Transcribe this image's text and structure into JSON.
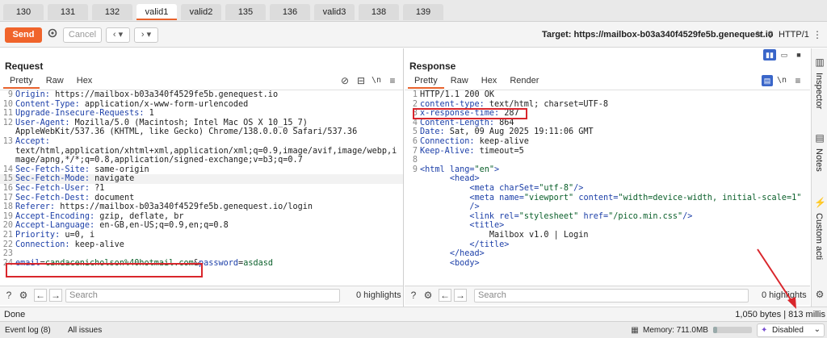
{
  "tabs": [
    "130",
    "131",
    "132",
    "valid1",
    "valid2",
    "135",
    "136",
    "valid3",
    "138",
    "139"
  ],
  "active_tab": "valid1",
  "toolbar": {
    "send_label": "Send",
    "cancel_label": "Cancel",
    "target_label": "Target: https://mailbox-b03a340f4529fe5b.genequest.io",
    "http_version": "HTTP/1"
  },
  "request": {
    "title": "Request",
    "tabs": [
      "Pretty",
      "Raw",
      "Hex"
    ],
    "newline_label": "\\n",
    "lines": [
      {
        "n": "9",
        "k": "Origin:",
        "v": " https://mailbox-b03a340f4529fe5b.genequest.io"
      },
      {
        "n": "10",
        "k": "Content-Type:",
        "v": " application/x-www-form-urlencoded"
      },
      {
        "n": "11",
        "k": "Upgrade-Insecure-Requests:",
        "v": " 1"
      },
      {
        "n": "12",
        "k": "User-Agent:",
        "v": " Mozilla/5.0 (Macintosh; Intel Mac OS X 10_15_7)"
      },
      {
        "n": "",
        "k": "",
        "v": "AppleWebKit/537.36 (KHTML, like Gecko) Chrome/138.0.0.0 Safari/537.36"
      },
      {
        "n": "13",
        "k": "Accept:",
        "v": ""
      },
      {
        "n": "",
        "k": "",
        "v": "text/html,application/xhtml+xml,application/xml;q=0.9,image/avif,image/webp,i"
      },
      {
        "n": "",
        "k": "",
        "v": "mage/apng,*/*;q=0.8,application/signed-exchange;v=b3;q=0.7"
      },
      {
        "n": "14",
        "k": "Sec-Fetch-Site:",
        "v": " same-origin"
      },
      {
        "n": "15",
        "k": "Sec-Fetch-Mode:",
        "v": " navigate"
      },
      {
        "n": "16",
        "k": "Sec-Fetch-User:",
        "v": " ?1"
      },
      {
        "n": "17",
        "k": "Sec-Fetch-Dest:",
        "v": " document"
      },
      {
        "n": "18",
        "k": "Referer:",
        "v": " https://mailbox-b03a340f4529fe5b.genequest.io/login"
      },
      {
        "n": "19",
        "k": "Accept-Encoding:",
        "v": " gzip, deflate, br"
      },
      {
        "n": "20",
        "k": "Accept-Language:",
        "v": " en-GB,en-US;q=0.9,en;q=0.8"
      },
      {
        "n": "21",
        "k": "Priority:",
        "v": " u=0, i"
      },
      {
        "n": "22",
        "k": "Connection:",
        "v": " keep-alive"
      },
      {
        "n": "23",
        "k": "",
        "v": ""
      }
    ],
    "body_line": {
      "n": "24",
      "p1k": "email",
      "p1v": "candacenicholson%40hotmail.com",
      "amp": "&",
      "p2k": "password",
      "p2v": "asdasd"
    },
    "search_placeholder": "Search",
    "highlights": "0 highlights"
  },
  "response": {
    "title": "Response",
    "tabs": [
      "Pretty",
      "Raw",
      "Hex",
      "Render"
    ],
    "newline_label": "\\n",
    "header_lines": [
      {
        "n": "1",
        "k": "",
        "v": "HTTP/1.1 200 OK"
      },
      {
        "n": "2",
        "k": "content-type:",
        "v": " text/html; charset=UTF-8"
      },
      {
        "n": "3",
        "k": "x-response-time:",
        "v": " 287"
      },
      {
        "n": "4",
        "k": "Content-Length:",
        "v": " 864"
      },
      {
        "n": "5",
        "k": "Date:",
        "v": " Sat, 09 Aug 2025 19:11:06 GMT"
      },
      {
        "n": "6",
        "k": "Connection:",
        "v": " keep-alive"
      },
      {
        "n": "7",
        "k": "Keep-Alive:",
        "v": " timeout=5"
      },
      {
        "n": "8",
        "k": "",
        "v": ""
      }
    ],
    "html_lines": [
      {
        "n": "9",
        "indent": "",
        "parts": [
          [
            "t",
            "<html "
          ],
          [
            "a",
            "lang"
          ],
          [
            "t",
            "="
          ],
          [
            "s",
            "\"en\""
          ],
          [
            "t",
            ">"
          ]
        ]
      },
      {
        "n": "",
        "indent": "      ",
        "parts": [
          [
            "t",
            "<head>"
          ]
        ]
      },
      {
        "n": "",
        "indent": "          ",
        "parts": [
          [
            "t",
            "<meta "
          ],
          [
            "a",
            "charSet"
          ],
          [
            "t",
            "="
          ],
          [
            "s",
            "\"utf-8\""
          ],
          [
            "t",
            "/>"
          ]
        ]
      },
      {
        "n": "",
        "indent": "          ",
        "parts": [
          [
            "t",
            "<meta "
          ],
          [
            "a",
            "name"
          ],
          [
            "t",
            "="
          ],
          [
            "s",
            "\"viewport\""
          ],
          [
            "t",
            " "
          ],
          [
            "a",
            "content"
          ],
          [
            "t",
            "="
          ],
          [
            "s",
            "\"width=device-width, initial-scale=1\""
          ]
        ]
      },
      {
        "n": "",
        "indent": "          ",
        "parts": [
          [
            "t",
            "/>"
          ]
        ]
      },
      {
        "n": "",
        "indent": "          ",
        "parts": [
          [
            "t",
            "<link "
          ],
          [
            "a",
            "rel"
          ],
          [
            "t",
            "="
          ],
          [
            "s",
            "\"stylesheet\""
          ],
          [
            "t",
            " "
          ],
          [
            "a",
            "href"
          ],
          [
            "t",
            "="
          ],
          [
            "s",
            "\"/pico.min.css\""
          ],
          [
            "t",
            "/>"
          ]
        ]
      },
      {
        "n": "",
        "indent": "          ",
        "parts": [
          [
            "t",
            "<title>"
          ]
        ]
      },
      {
        "n": "",
        "indent": "              ",
        "parts": [
          [
            "p",
            "Mailbox v1.0 | Login"
          ]
        ]
      },
      {
        "n": "",
        "indent": "          ",
        "parts": [
          [
            "t",
            "</title>"
          ]
        ]
      },
      {
        "n": "",
        "indent": "      ",
        "parts": [
          [
            "t",
            "</head>"
          ]
        ]
      },
      {
        "n": "",
        "indent": "      ",
        "parts": [
          [
            "t",
            "<body>"
          ]
        ]
      }
    ],
    "search_placeholder": "Search",
    "highlights": "0 highlights"
  },
  "sidebar": {
    "inspector": "Inspector",
    "notes": "Notes",
    "custom": "Custom acti"
  },
  "status": {
    "left": "Done",
    "right": "1,050 bytes | 813 millis"
  },
  "bottombar": {
    "event_log": "Event log (8)",
    "all_issues": "All issues",
    "memory": "Memory: 711.0MB",
    "disabled": "Disabled"
  },
  "colors": {
    "accent": "#f0642b",
    "annotation_red": "#d9262c"
  }
}
